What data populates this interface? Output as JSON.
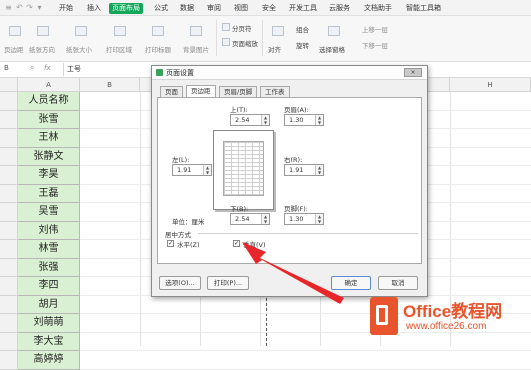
{
  "tabs": [
    "开始",
    "插入",
    "页面布局",
    "公式",
    "数据",
    "审阅",
    "视图",
    "安全",
    "开发工具",
    "云服务",
    "文档助手",
    "智能工具箱"
  ],
  "active_tab": "页面布局",
  "ribbon": {
    "page_margins": "页边距",
    "paper_direction": "纸张方向",
    "paper_size": "纸张大小",
    "print_area": "打印区域",
    "print_titles": "打印标题",
    "background": "背景图片",
    "page_break": "分页符",
    "page_zoom": "页面缩放",
    "align": "对齐",
    "group": "组合",
    "rotate": "旋转",
    "selection_pane": "选择窗格",
    "bring_forward": "上移一层",
    "send_backward": "下移一层"
  },
  "formula_bar": {
    "cell_ref": "B",
    "fx": "fx",
    "content": "工号"
  },
  "columns": [
    "A",
    "B",
    "C",
    "D",
    "E",
    "F",
    "G",
    "H"
  ],
  "column_a": [
    "人员名称",
    "张雪",
    "王林",
    "张静文",
    "李昊",
    "王磊",
    "吴雪",
    "刘伟",
    "林雪",
    "张强",
    "李四",
    "胡月",
    "刘萌萌",
    "李大宝",
    "高婷婷"
  ],
  "dialog": {
    "title": "页面设置",
    "tabs": [
      "页面",
      "页边距",
      "页眉/页脚",
      "工作表"
    ],
    "active_tab": "页边距",
    "top_label": "上(T):",
    "top_value": "2.54",
    "header_label": "页眉(A):",
    "header_value": "1.30",
    "left_label": "左(L):",
    "left_value": "1.91",
    "right_label": "右(R):",
    "right_value": "1.91",
    "bottom_label": "下(B):",
    "bottom_value": "2.54",
    "footer_label": "页脚(F):",
    "footer_value": "1.30",
    "unit_label": "单位：厘米",
    "center_section": "居中方式",
    "horizontal_label": "水平(Z)",
    "vertical_label": "垂直(V)",
    "horizontal_checked": true,
    "vertical_checked": true,
    "options_button": "选项(O)...",
    "print_button": "打印(P)...",
    "ok_button": "确定",
    "cancel_button": "取消"
  },
  "watermark": {
    "brand": "Office教程网",
    "url": "www.office26.com"
  },
  "colors": {
    "accent": "#12a65a",
    "highlight_cell": "#daf0d3",
    "arrow": "#e8262a",
    "logo": "#e8552d"
  }
}
